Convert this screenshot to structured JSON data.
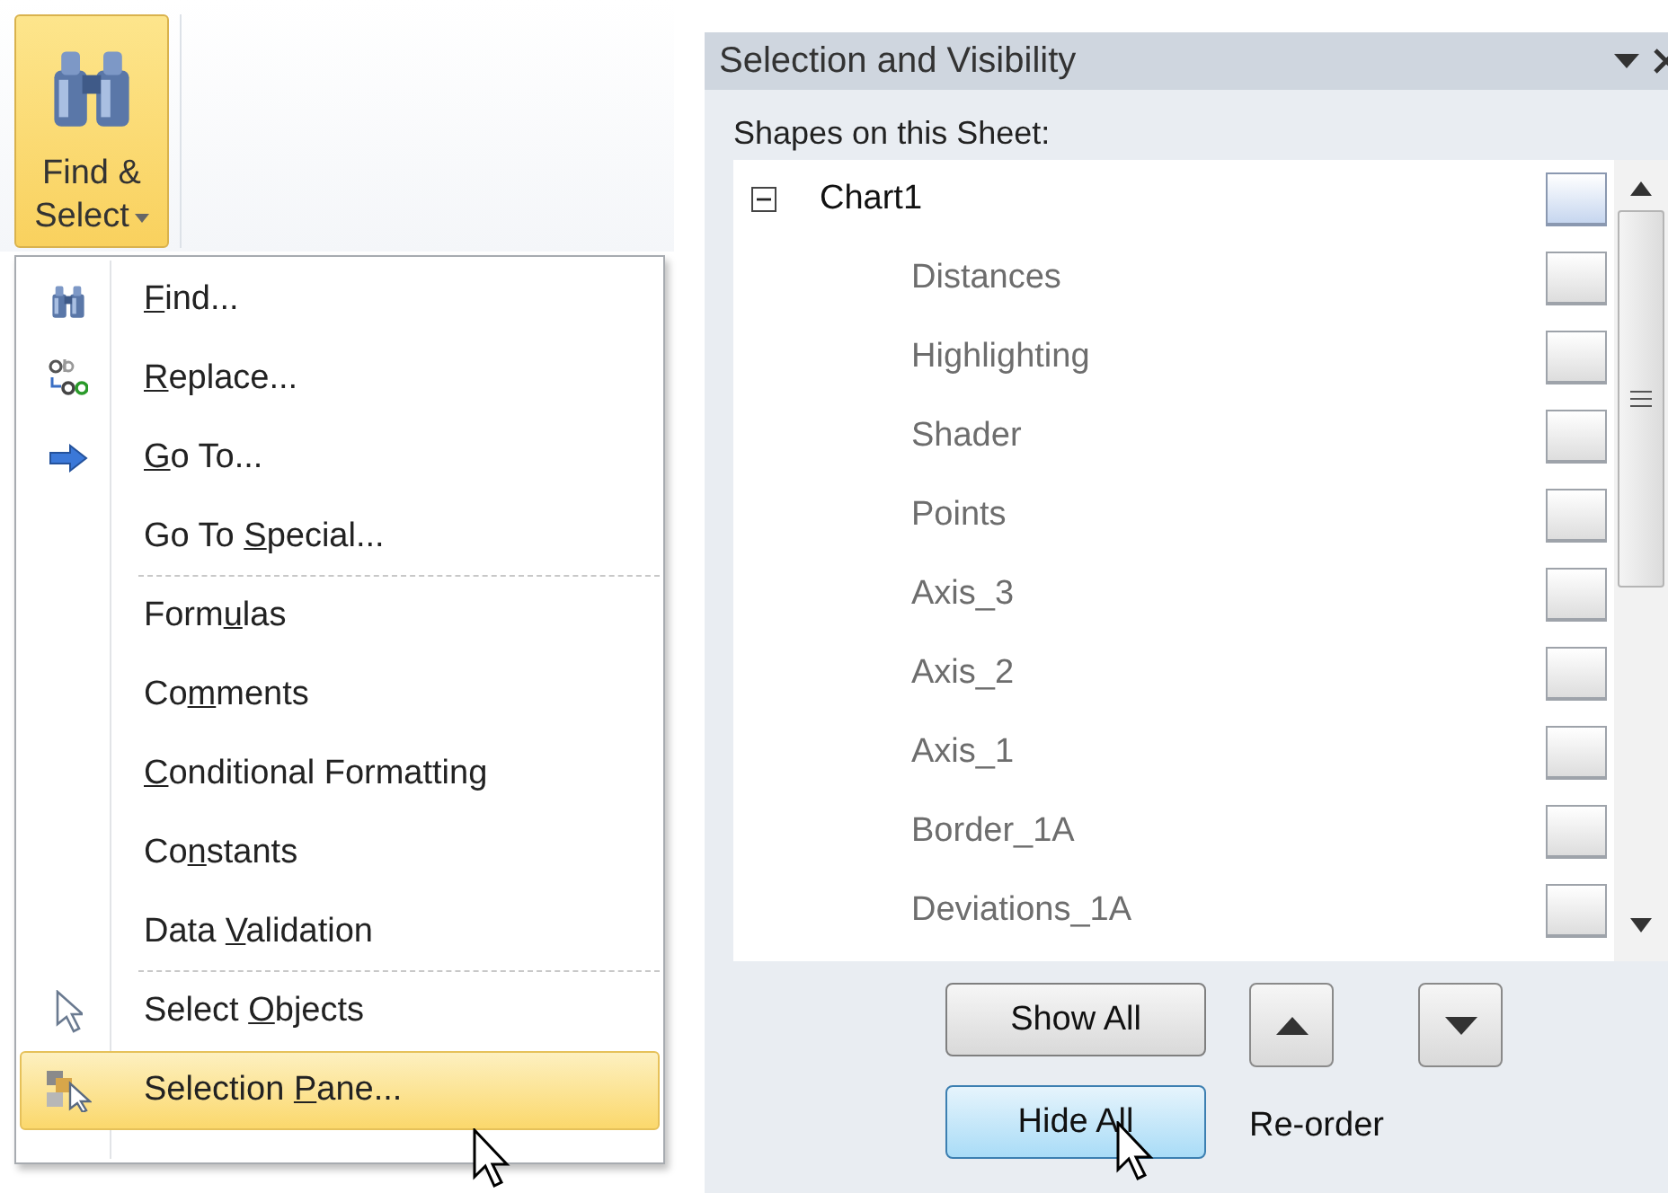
{
  "ribbon": {
    "find_select_button": {
      "lines": [
        "Find &",
        "Select"
      ],
      "active": true
    }
  },
  "menu": {
    "groups": [
      [
        {
          "parts": [
            "F",
            "ind..."
          ],
          "highlighted": false
        },
        {
          "parts": [
            "R",
            "eplace..."
          ],
          "highlighted": false
        },
        {
          "parts": [
            "G",
            "o To..."
          ],
          "highlighted": false
        },
        {
          "parts": [
            "Go To ",
            "S",
            "pecial..."
          ],
          "highlighted": false
        }
      ],
      [
        {
          "parts": [
            "Form",
            "u",
            "las"
          ],
          "highlighted": false
        },
        {
          "parts": [
            "Co",
            "m",
            "ments"
          ],
          "highlighted": false
        },
        {
          "parts": [
            "C",
            "onditional Formatting"
          ],
          "highlighted": false
        },
        {
          "parts": [
            "Co",
            "n",
            "stants"
          ],
          "highlighted": false
        },
        {
          "parts": [
            "Data ",
            "V",
            "alidation"
          ],
          "highlighted": false
        }
      ],
      [
        {
          "parts": [
            "Select ",
            "O",
            "bjects"
          ],
          "highlighted": false
        },
        {
          "parts": [
            "Selection ",
            "P",
            "ane..."
          ],
          "highlighted": true
        }
      ]
    ]
  },
  "pane": {
    "title": "Selection and Visibility",
    "list_label": "Shapes on this Sheet:",
    "tree": [
      {
        "name": "Chart1",
        "expanded": true,
        "highlighted": true,
        "children": [
          {
            "name": "Distances",
            "highlighted": false
          },
          {
            "name": "Highlighting",
            "highlighted": false
          },
          {
            "name": "Shader",
            "highlighted": false
          },
          {
            "name": "Points",
            "highlighted": false
          },
          {
            "name": "Axis_3",
            "highlighted": false
          },
          {
            "name": "Axis_2",
            "highlighted": false
          },
          {
            "name": "Axis_1",
            "highlighted": false
          },
          {
            "name": "Border_1A",
            "highlighted": false
          },
          {
            "name": "Deviations_1A",
            "highlighted": false
          }
        ]
      }
    ],
    "buttons": [
      {
        "label": "Show All",
        "hovered": false
      },
      {
        "label": "Hide All",
        "hovered": true
      }
    ],
    "reorder_label": "Re-order"
  }
}
